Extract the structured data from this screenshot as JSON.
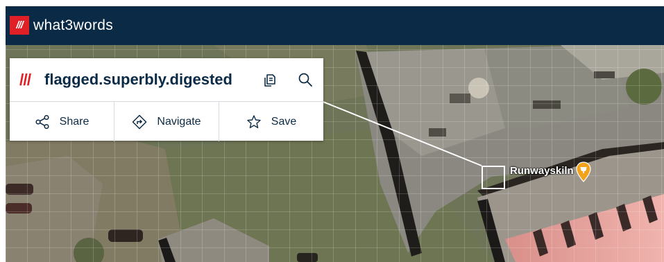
{
  "header": {
    "logo_mark": "///",
    "brand": "what3words",
    "bg_color": "#0b2a45",
    "accent_color": "#e11f26"
  },
  "address_card": {
    "prefix": "///",
    "address": "flagged.superbly.digested",
    "copy_icon": "copy-icon",
    "search_icon": "search-icon",
    "actions": [
      {
        "label": "Share",
        "icon": "share-icon"
      },
      {
        "label": "Navigate",
        "icon": "navigate-icon"
      },
      {
        "label": "Save",
        "icon": "star-icon"
      }
    ]
  },
  "map": {
    "poi": {
      "label": "Runwayskiln",
      "icon": "cafe-pin-icon",
      "pin_color": "#f3a21b"
    },
    "grid_color": "#ffffff"
  }
}
